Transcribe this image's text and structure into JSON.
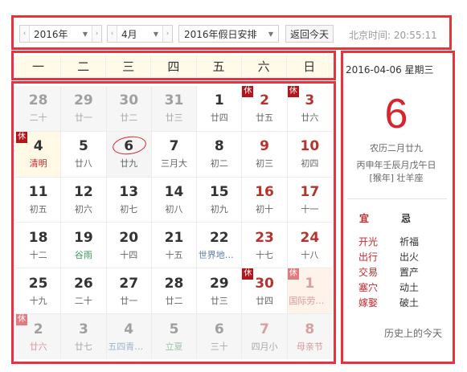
{
  "toolbar": {
    "year_value": "2016年",
    "month_value": "4月",
    "holiday_schedule_value": "2016年假日安排",
    "today_button_label": "返回今天",
    "beijing_time_label": "北京时间:",
    "beijing_time_value": "20:55:11"
  },
  "weekdays": [
    "一",
    "二",
    "三",
    "四",
    "五",
    "六",
    "日"
  ],
  "holiday_badge_text": "休",
  "calendar": {
    "rows": [
      [
        {
          "day": "28",
          "lunar": "二十",
          "other": true
        },
        {
          "day": "29",
          "lunar": "廿一",
          "other": true
        },
        {
          "day": "30",
          "lunar": "廿二",
          "other": true
        },
        {
          "day": "31",
          "lunar": "廿三",
          "other": true
        },
        {
          "day": "1",
          "lunar": "廿四"
        },
        {
          "day": "2",
          "lunar": "廿五",
          "weekend": true,
          "badge": true
        },
        {
          "day": "3",
          "lunar": "廿六",
          "weekend": true,
          "badge": true
        }
      ],
      [
        {
          "day": "4",
          "lunar": "清明",
          "lunar_type": "festival",
          "badge": true,
          "selected": true
        },
        {
          "day": "5",
          "lunar": "廿八"
        },
        {
          "day": "6",
          "lunar": "廿九",
          "today": true
        },
        {
          "day": "7",
          "lunar": "三月大"
        },
        {
          "day": "8",
          "lunar": "初二"
        },
        {
          "day": "9",
          "lunar": "初三",
          "weekend": true
        },
        {
          "day": "10",
          "lunar": "初四",
          "weekend": true
        }
      ],
      [
        {
          "day": "11",
          "lunar": "初五"
        },
        {
          "day": "12",
          "lunar": "初六"
        },
        {
          "day": "13",
          "lunar": "初七"
        },
        {
          "day": "14",
          "lunar": "初八"
        },
        {
          "day": "15",
          "lunar": "初九"
        },
        {
          "day": "16",
          "lunar": "初十",
          "weekend": true
        },
        {
          "day": "17",
          "lunar": "十一",
          "weekend": true
        }
      ],
      [
        {
          "day": "18",
          "lunar": "十二"
        },
        {
          "day": "19",
          "lunar": "谷雨",
          "lunar_type": "term"
        },
        {
          "day": "20",
          "lunar": "十四"
        },
        {
          "day": "21",
          "lunar": "十五"
        },
        {
          "day": "22",
          "lunar": "世界地球...",
          "lunar_type": "intl"
        },
        {
          "day": "23",
          "lunar": "十七",
          "weekend": true
        },
        {
          "day": "24",
          "lunar": "十八",
          "weekend": true
        }
      ],
      [
        {
          "day": "25",
          "lunar": "十九"
        },
        {
          "day": "26",
          "lunar": "二十"
        },
        {
          "day": "27",
          "lunar": "廿一"
        },
        {
          "day": "28",
          "lunar": "廿二"
        },
        {
          "day": "29",
          "lunar": "廿三"
        },
        {
          "day": "30",
          "lunar": "廿四",
          "weekend": true,
          "badge": true
        },
        {
          "day": "1",
          "lunar": "国际劳动...",
          "lunar_type": "festival",
          "weekend": true,
          "other": true,
          "other_today": true,
          "badge": true,
          "badge_faded": true
        }
      ],
      [
        {
          "day": "2",
          "lunar": "廿六",
          "lunar_type": "festival",
          "other": true,
          "badge": true,
          "badge_faded": true
        },
        {
          "day": "3",
          "lunar": "廿七",
          "other": true
        },
        {
          "day": "4",
          "lunar": "五四青年...",
          "lunar_type": "intl",
          "other": true
        },
        {
          "day": "5",
          "lunar": "立夏",
          "lunar_type": "term",
          "other": true
        },
        {
          "day": "6",
          "lunar": "三十",
          "other": true
        },
        {
          "day": "7",
          "lunar": "四月小",
          "weekend": true,
          "other": true
        },
        {
          "day": "8",
          "lunar": "母亲节",
          "lunar_type": "festival",
          "weekend": true,
          "other": true
        }
      ]
    ]
  },
  "detail": {
    "date_line": "2016-04-06  星期三",
    "big_day": "6",
    "lunar_date": "农历二月廿九",
    "ganzhi": "丙申年壬辰月戊午日",
    "sha": "[猴年] 壮羊座",
    "yi_label": "宜",
    "ji_label": "忌",
    "yi_items": [
      "开光",
      "出行",
      "交易",
      "塞穴",
      "嫁娶"
    ],
    "ji_items": [
      "祈福",
      "出火",
      "置产",
      "动土",
      "破土"
    ],
    "history_link": "历史上的今天"
  },
  "colors": {
    "annotation_frame": "#e8323c",
    "accent_red": "#d9232d",
    "weekend_red": "#b3352e",
    "holiday_badge": "#b3151b",
    "solar_term_green": "#3f9a56",
    "intl_day_blue": "#5c7fa8",
    "header_bg": "#fffbe8"
  },
  "icons": {
    "prev": "chevron-left-icon",
    "next": "chevron-right-icon",
    "dropdown": "caret-down-icon"
  }
}
